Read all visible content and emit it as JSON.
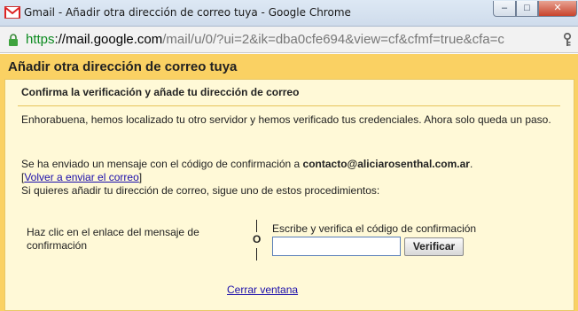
{
  "window": {
    "title": "Gmail - Añadir otra dirección de correo tuya - Google Chrome",
    "minimize_glyph": "–",
    "maximize_glyph": "□",
    "close_glyph": "✕"
  },
  "address_bar": {
    "scheme": "https",
    "host": "://mail.google.com",
    "path": "/mail/u/0/?ui=2&ik=dba0cfe694&view=cf&cfmf=true&cfa=c"
  },
  "dialog": {
    "title": "Añadir otra dirección de correo tuya",
    "subtitle": "Confirma la verificación y añade tu dirección de correo",
    "congrats_text": "Enhorabuena, hemos localizado tu otro servidor y hemos verificado tus credenciales. Ahora solo queda un paso.",
    "sent_text": "Se ha enviado un mensaje con el código de confirmación a ",
    "email": "contacto@aliciarosenthal.com.ar",
    "sent_suffix": ".",
    "resend_open": "[",
    "resend_link": "Volver a enviar el correo",
    "resend_close": "]",
    "instructions": "Si quieres añadir tu dirección de correo, sigue uno de estos procedimientos:",
    "option_link_text": "Haz clic en el enlace del mensaje de confirmación",
    "separator": "O",
    "option_code_label": "Escribe y verifica el código de confirmación",
    "code_input_value": "",
    "verify_button": "Verificar",
    "close_link": "Cerrar ventana"
  },
  "colors": {
    "dialog_header": "#fad163",
    "dialog_body": "#fff9d7",
    "link": "#1a0dab",
    "https_green": "#0b8a1f"
  }
}
